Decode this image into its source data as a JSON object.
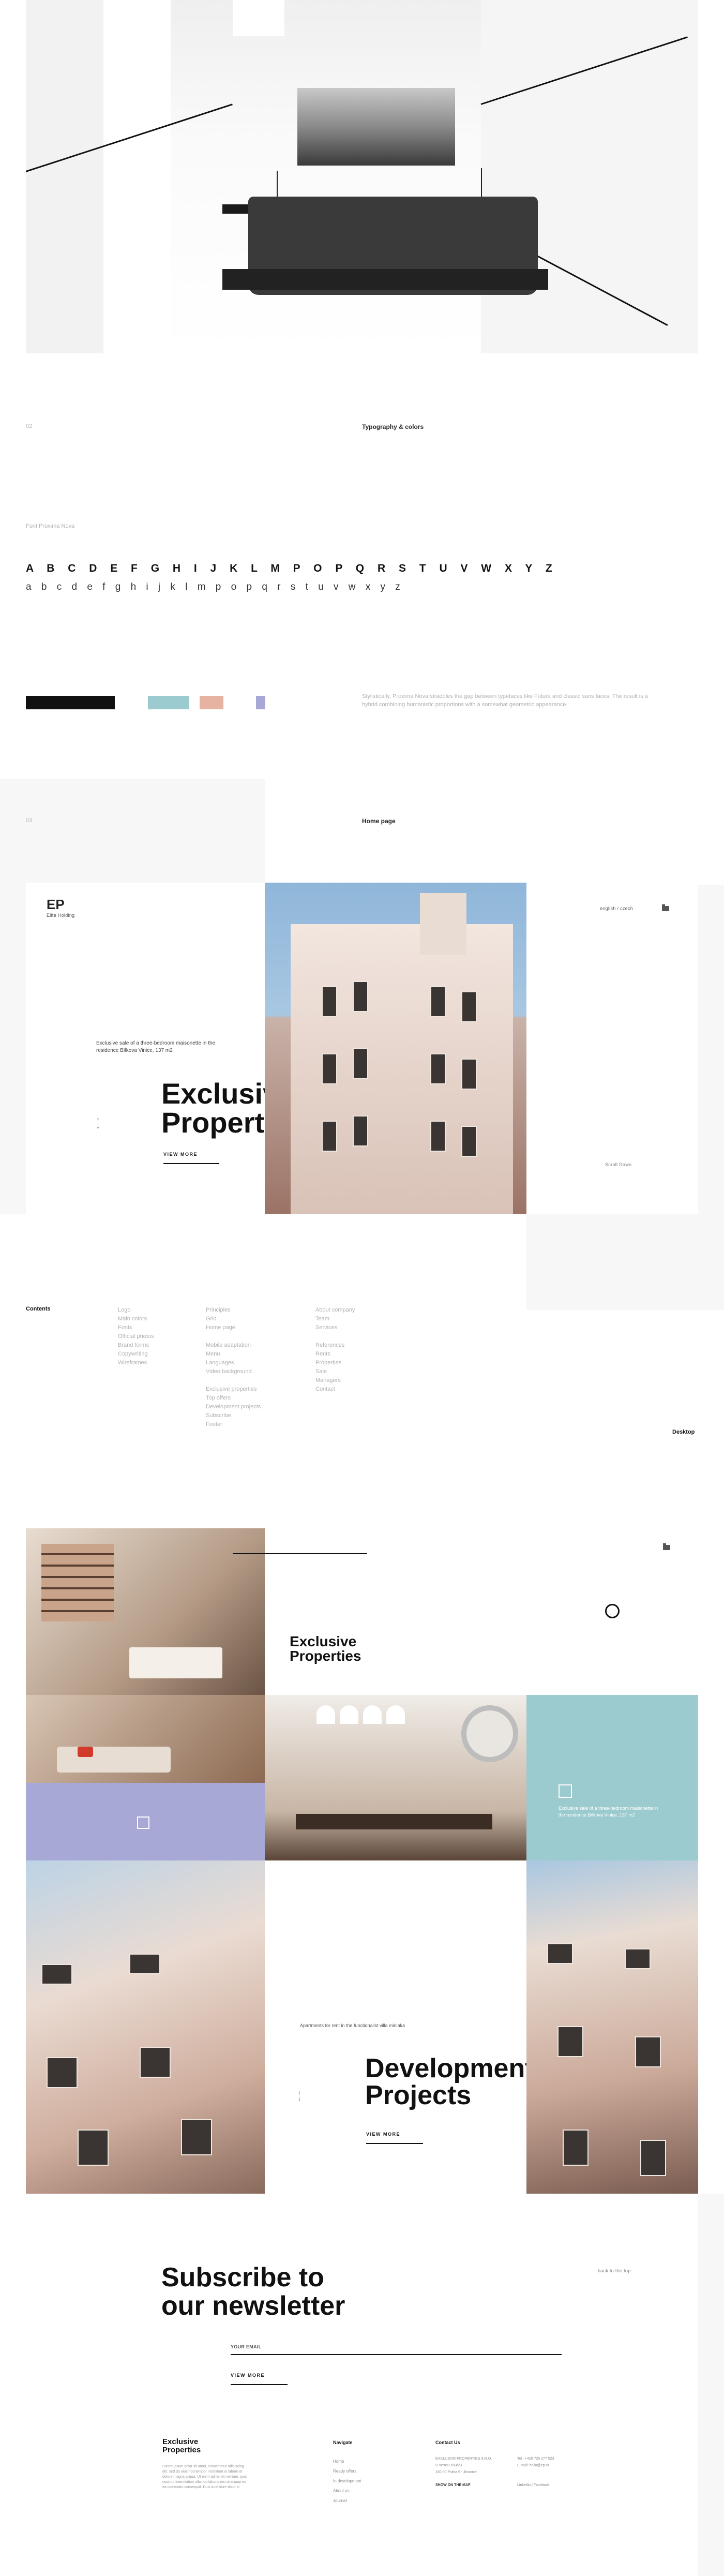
{
  "typography_section": {
    "number": "02",
    "title": "Typography & colors",
    "font_name": "Font Proxima Nova",
    "uppercase": "A B C D E F G H I J K L M P O P Q R S T U V W X Y Z",
    "lowercase": "a b c d e f g h i j k l m p o p q r s t u v w x y z",
    "colors": [
      "#111111",
      "#9ccbcf",
      "#e6b3a3",
      "#a8a8d6"
    ],
    "description": "Stylistically, Proxima Nova straddles the gap between typefaces like Futura and classic sans faces. The result is a hybrid combining humanistic proportions with a somewhat geometric appearance."
  },
  "homepage_section": {
    "number": "03",
    "title": "Home page"
  },
  "home_mock": {
    "logo": "Elite Holding",
    "intro": "Exclusive sale of a three-bedroom maisonette in the residence Bílkova Vinice, 137 m2",
    "title_line1": "Exclusive",
    "title_line2": "Properties",
    "view_more": "VIEW MORE",
    "lang": "english / czech",
    "scroll_label": "Scroll Down"
  },
  "contents": {
    "label": "Contents",
    "col1": [
      "Logo",
      "Main colors",
      "Fonts",
      "Official photos",
      "Brand forms",
      "Copywriting",
      "Wireframes"
    ],
    "col2a": [
      "Principles",
      "Grid",
      "Home page"
    ],
    "col2b": [
      "Mobile adaptation",
      "Menu",
      "Languages",
      "Video background"
    ],
    "col2c": [
      "Exclusive properties",
      "Top offers",
      "Development projects",
      "Subscribe",
      "Footer"
    ],
    "col3a": [
      "About company",
      "Team",
      "Services"
    ],
    "col3b": [
      "References",
      "Rents",
      "Properties",
      "Sale",
      "Managers",
      "Contact"
    ],
    "desktop_label": "Desktop"
  },
  "desktop_mock": {
    "title_line1": "Exclusive",
    "title_line2": "Properties",
    "teal_text": "Exclusive sale of a three-bedroom maisonette in the residence Bílkova Vinice, 137 m2",
    "dev_intro": "Apartments for rent in the functionalist villa miniaka",
    "dev_line1": "Development",
    "dev_line2": "Projects",
    "view_more": "VIEW MORE"
  },
  "newsletter": {
    "line1": "Subscribe to",
    "line2": "our newsletter",
    "email_placeholder": "YOUR EMAIL",
    "button": "VIEW MORE",
    "side_note": "back to the top"
  },
  "footer": {
    "brand_line1": "Exclusive",
    "brand_line2": "Properties",
    "brand_text": "Lorem ipsum dolor sit amet, consectetur adipiscing elit, sed do eiusmod tempor incididunt ut labore et dolore magna aliqua. Ut enim ad minim veniam, quis nostrud exercitation ullamco laboris nisi ut aliquip ex ea commodo consequat. Duis aute irure dolor in",
    "nav_title": "Navigate",
    "nav_items": [
      "Home",
      "Ready offers",
      "In development",
      "About us",
      "Journal"
    ],
    "contact_title": "Contact Us",
    "contact_lines": [
      "EXCLUSIVE PROPERTIES S.R.O.",
      "U vzrusu 603/23",
      "150 00 Praha 5 - Jinonice"
    ],
    "show_map": "SHOW ON THE MAP",
    "phone": "Tel.: +420 725 277 523",
    "email": "E-mail: hello@ep.cz",
    "social": "Linkedin | Facebook"
  }
}
